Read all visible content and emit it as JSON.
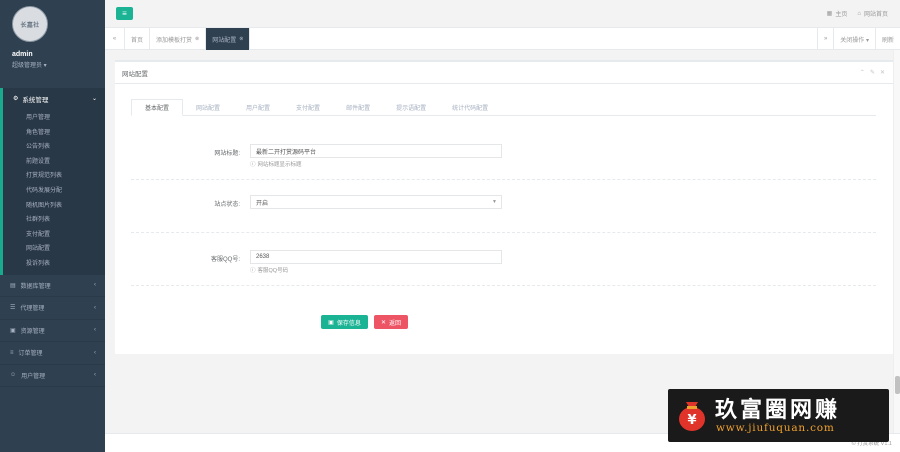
{
  "profile": {
    "avatar_text": "长嘉社",
    "name": "admin",
    "role": "超级管理员 ▾"
  },
  "sidebar": {
    "active_section": {
      "label": "系统管理",
      "icon": "gear-icon"
    },
    "sub_items": [
      {
        "label": "用户管理"
      },
      {
        "label": "角色管理"
      },
      {
        "label": "公告列表"
      },
      {
        "label": "前题设置"
      },
      {
        "label": "打赏规范列表"
      },
      {
        "label": "代码发展分配"
      },
      {
        "label": "随机图片列表"
      },
      {
        "label": "社群列表"
      },
      {
        "label": "支付配置"
      },
      {
        "label": "网站配置"
      },
      {
        "label": "投诉列表"
      }
    ],
    "items": [
      {
        "label": "数据库管理",
        "icon": "database-icon"
      },
      {
        "label": "代理管理",
        "icon": "users-icon"
      },
      {
        "label": "资源管理",
        "icon": "folder-icon"
      },
      {
        "label": "订单管理",
        "icon": "list-icon"
      },
      {
        "label": "用户管理",
        "icon": "user-icon"
      }
    ]
  },
  "topbar": {
    "menu_icon": "menu-icon",
    "right_links": [
      {
        "icon": "grid-icon",
        "label": "主页"
      },
      {
        "icon": "home-icon",
        "label": "网站首页"
      }
    ]
  },
  "tabs": {
    "items": [
      {
        "label": "首页",
        "closable": false,
        "active": false
      },
      {
        "label": "添加模板打赏",
        "closable": true,
        "active": false
      },
      {
        "label": "网站配置",
        "closable": true,
        "active": true
      }
    ],
    "right": [
      "关闭操作 ▾",
      "刷新"
    ]
  },
  "panel": {
    "title": "网站配置",
    "form_tabs": [
      "基本配置",
      "网站配置",
      "用户配置",
      "支付配置",
      "邮件配置",
      "提示语配置",
      "统计代码配置"
    ],
    "fields": {
      "site_title": {
        "label": "网站标题:",
        "value": "最新二开打赏源码平台",
        "help": "网站标题显示标题"
      },
      "site_status": {
        "label": "站点状态:",
        "value": "开启"
      },
      "customer_qq": {
        "label": "客服QQ号:",
        "value": "2638",
        "help": "客服QQ号码"
      }
    },
    "buttons": {
      "save": "保存信息",
      "back": "返回"
    }
  },
  "footer": {
    "text": "© 打赏系统 V1.1"
  },
  "watermark": {
    "name": "玖富圈网赚",
    "url": "www.jiufuquan.com"
  }
}
